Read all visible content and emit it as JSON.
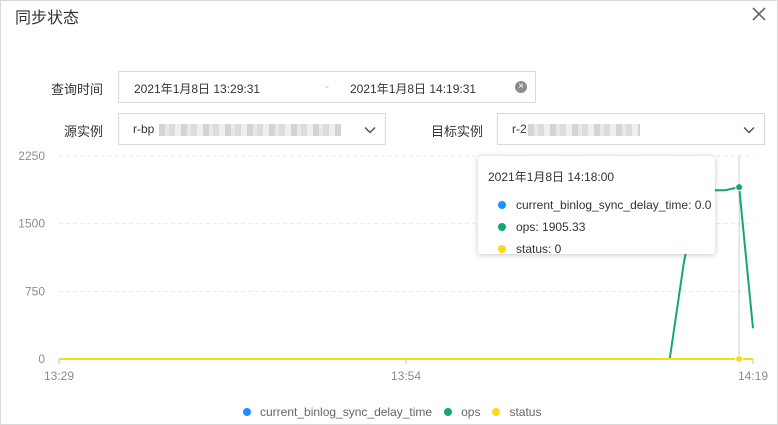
{
  "dialog": {
    "title": "同步状态"
  },
  "query": {
    "label": "查询时间",
    "start": "2021年1月8日 13:29:31",
    "separator": "-",
    "end": "2021年1月8日 14:19:31"
  },
  "source": {
    "label": "源实例",
    "value_prefix": "r-bp"
  },
  "target": {
    "label": "目标实例",
    "value_prefix": "r-2"
  },
  "colors": {
    "delay": "#1890ff",
    "ops": "#13a774",
    "status": "#fadb14"
  },
  "tooltip": {
    "time": "2021年1月8日 14:18:00",
    "items": [
      {
        "text": "current_binlog_sync_delay_time: 0.0"
      },
      {
        "text": "ops: 1905.33"
      },
      {
        "text": "status: 0"
      }
    ]
  },
  "legend": [
    {
      "name": "current_binlog_sync_delay_time"
    },
    {
      "name": "ops"
    },
    {
      "name": "status"
    }
  ],
  "chart_data": {
    "type": "line",
    "x_ticks": [
      "13:29",
      "13:54",
      "14:19"
    ],
    "y_ticks": [
      "2250",
      "1500",
      "750",
      "0"
    ],
    "ylim": [
      0,
      2250
    ],
    "grid": true,
    "legend_position": "bottom",
    "hover_x": 49,
    "series": [
      {
        "name": "current_binlog_sync_delay_time",
        "points": [
          [
            0,
            0
          ],
          [
            50,
            0
          ]
        ]
      },
      {
        "name": "ops",
        "points": [
          [
            0,
            0
          ],
          [
            44,
            0
          ],
          [
            45,
            1050
          ],
          [
            46,
            1870
          ],
          [
            48,
            1870
          ],
          [
            49,
            1905
          ],
          [
            50,
            340
          ]
        ]
      },
      {
        "name": "status",
        "points": [
          [
            0,
            0
          ],
          [
            50,
            0
          ]
        ]
      }
    ]
  }
}
